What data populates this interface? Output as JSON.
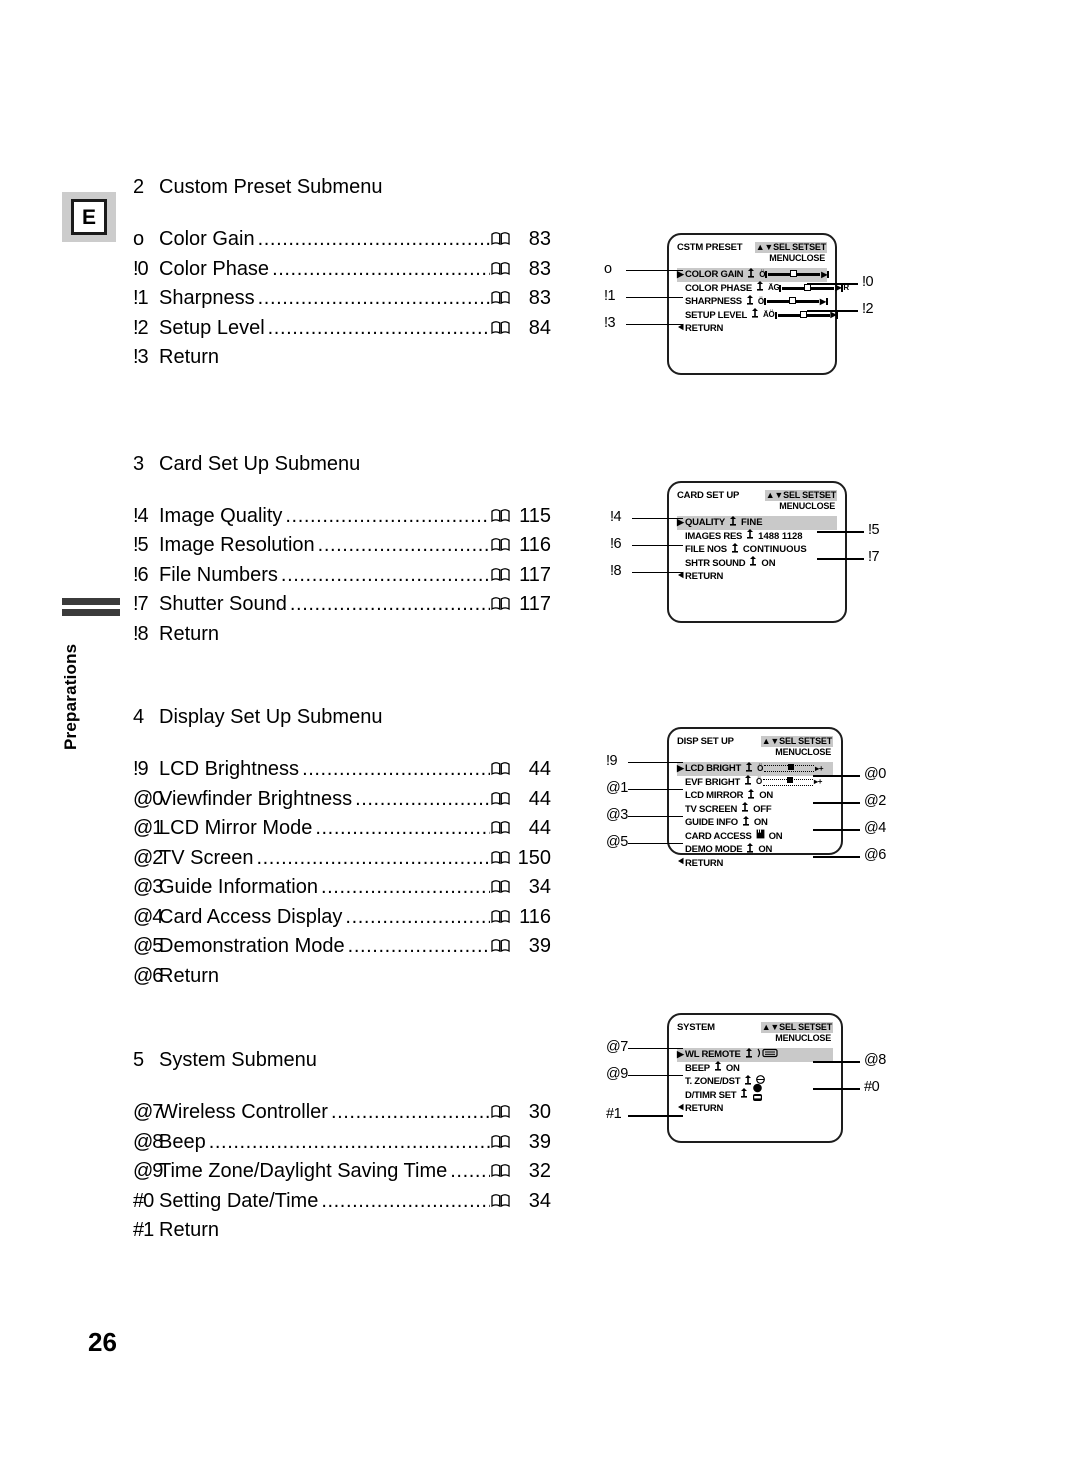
{
  "page": {
    "number": "26",
    "language_badge": "E",
    "side_tab_label": "Preparations"
  },
  "toc": {
    "groups": [
      {
        "num": "2",
        "title": "Custom Preset Submenu",
        "rows": [
          {
            "key": "o",
            "label": "Color Gain",
            "icon": "book-icon",
            "page": "83"
          },
          {
            "key": "!0",
            "label": "Color Phase",
            "icon": "book-icon",
            "page": "83"
          },
          {
            "key": "!1",
            "label": "Sharpness",
            "icon": "book-icon",
            "page": "83"
          },
          {
            "key": "!2",
            "label": "Setup Level",
            "icon": "book-icon",
            "page": "84"
          },
          {
            "key": "!3",
            "label": "Return",
            "icon": "",
            "page": ""
          }
        ]
      },
      {
        "num": "3",
        "title": "Card Set Up Submenu",
        "rows": [
          {
            "key": "!4",
            "label": "Image Quality",
            "icon": "book-icon",
            "page": "115"
          },
          {
            "key": "!5",
            "label": "Image Resolution",
            "icon": "book-icon",
            "page": "116"
          },
          {
            "key": "!6",
            "label": "File Numbers",
            "icon": "book-icon",
            "page": "117"
          },
          {
            "key": "!7",
            "label": "Shutter Sound",
            "icon": "book-icon",
            "page": "117"
          },
          {
            "key": "!8",
            "label": "Return",
            "icon": "",
            "page": ""
          }
        ]
      },
      {
        "num": "4",
        "title": "Display Set Up Submenu",
        "rows": [
          {
            "key": "!9",
            "label": "LCD Brightness",
            "icon": "book-icon",
            "page": "44"
          },
          {
            "key": "@0",
            "label": "Viewfinder Brightness",
            "icon": "book-icon",
            "page": "44"
          },
          {
            "key": "@1",
            "label": "LCD Mirror Mode",
            "icon": "book-icon",
            "page": "44"
          },
          {
            "key": "@2",
            "label": "TV Screen",
            "icon": "book-icon",
            "page": "150"
          },
          {
            "key": "@3",
            "label": "Guide Information",
            "icon": "book-icon",
            "page": "34"
          },
          {
            "key": "@4",
            "label": "Card Access Display",
            "icon": "book-icon",
            "page": "116"
          },
          {
            "key": "@5",
            "label": "Demonstration Mode",
            "icon": "book-icon",
            "page": "39"
          },
          {
            "key": "@6",
            "label": "Return",
            "icon": "",
            "page": ""
          }
        ]
      },
      {
        "num": "5",
        "title": "System Submenu",
        "rows": [
          {
            "key": "@7",
            "label": "Wireless Controller",
            "icon": "book-icon",
            "page": "30"
          },
          {
            "key": "@8",
            "label": "Beep",
            "icon": "book-icon",
            "page": "39"
          },
          {
            "key": "@9",
            "label": "Time Zone/Daylight Saving Time",
            "icon": "book-icon",
            "page": "32"
          },
          {
            "key": "#0",
            "label": "Setting Date/Time",
            "icon": "book-icon",
            "page": "34"
          },
          {
            "key": "#1",
            "label": "Return",
            "icon": "",
            "page": ""
          }
        ]
      }
    ]
  },
  "figures": {
    "hint_line1": "SEL SETSET",
    "hint_line2": "MENUCLOSE",
    "screens": [
      {
        "title": "CSTM PRESET",
        "rows": [
          {
            "name": "COLOR GAIN",
            "value": "",
            "selected": true,
            "widget": "slider-center",
            "cap_left": "Ö",
            "cap_right": ""
          },
          {
            "name": "COLOR PHASE",
            "value": "",
            "selected": false,
            "widget": "slider-center",
            "cap_left": "ÄG",
            "cap_right": "R"
          },
          {
            "name": "SHARPNESS",
            "value": "",
            "selected": false,
            "widget": "slider-center",
            "cap_left": "Ö",
            "cap_right": ""
          },
          {
            "name": "SETUP LEVEL",
            "value": "",
            "selected": false,
            "widget": "slider-center",
            "cap_left": "ÄÖ",
            "cap_right": ""
          },
          {
            "name": "RETURN",
            "value": "",
            "selected": false,
            "widget": "return",
            "cap_left": "",
            "cap_right": ""
          }
        ],
        "callouts_left": [
          {
            "label": "o",
            "row": 0
          },
          {
            "label": "!1",
            "row": 2
          },
          {
            "label": "!3",
            "row": 4
          }
        ],
        "callouts_right": [
          {
            "label": "!0",
            "row": 1
          },
          {
            "label": "!2",
            "row": 3
          }
        ]
      },
      {
        "title": "CARD SET UP",
        "rows": [
          {
            "name": "QUALITY",
            "value": "FINE",
            "selected": true,
            "widget": "text"
          },
          {
            "name": "IMAGES RES",
            "value": "1488  1128",
            "selected": false,
            "widget": "text"
          },
          {
            "name": "FILE NOS",
            "value": "CONTINUOUS",
            "selected": false,
            "widget": "text"
          },
          {
            "name": "SHTR SOUND",
            "value": "ON",
            "selected": false,
            "widget": "text"
          },
          {
            "name": "RETURN",
            "value": "",
            "selected": false,
            "widget": "return"
          }
        ],
        "callouts_left": [
          {
            "label": "!4",
            "row": 0
          },
          {
            "label": "!6",
            "row": 2
          },
          {
            "label": "!8",
            "row": 4
          }
        ],
        "callouts_right": [
          {
            "label": "!5",
            "row": 1
          },
          {
            "label": "!7",
            "row": 3
          }
        ]
      },
      {
        "title": "DISP SET UP",
        "rows": [
          {
            "name": "LCD BRIGHT",
            "value": "",
            "selected": true,
            "widget": "slider-dotted"
          },
          {
            "name": "EVF BRIGHT",
            "value": "",
            "selected": false,
            "widget": "slider-dotted"
          },
          {
            "name": "LCD MIRROR",
            "value": "ON",
            "selected": false,
            "widget": "text"
          },
          {
            "name": "TV SCREEN",
            "value": "OFF",
            "selected": false,
            "widget": "text"
          },
          {
            "name": "GUIDE INFO",
            "value": "ON",
            "selected": false,
            "widget": "text"
          },
          {
            "name": "CARD ACCESS",
            "value": "ON",
            "selected": false,
            "widget": "text"
          },
          {
            "name": "DEMO MODE",
            "value": "ON",
            "selected": false,
            "widget": "text"
          },
          {
            "name": "RETURN",
            "value": "",
            "selected": false,
            "widget": "return"
          }
        ],
        "callouts_left": [
          {
            "label": "!9",
            "row": 0
          },
          {
            "label": "@1",
            "row": 2
          },
          {
            "label": "@3",
            "row": 4
          },
          {
            "label": "@5",
            "row": 6
          }
        ],
        "callouts_right": [
          {
            "label": "@0",
            "row": 1
          },
          {
            "label": "@2",
            "row": 3
          },
          {
            "label": "@4",
            "row": 5
          },
          {
            "label": "@6",
            "row": 7
          }
        ]
      },
      {
        "title": "SYSTEM",
        "rows": [
          {
            "name": "WL REMOTE",
            "value": "",
            "selected": true,
            "widget": "remote"
          },
          {
            "name": "BEEP",
            "value": "ON",
            "selected": false,
            "widget": "text"
          },
          {
            "name": "T. ZONE/DST",
            "value": "",
            "selected": false,
            "widget": "zone"
          },
          {
            "name": "D/TIMR SET",
            "value": "",
            "selected": false,
            "widget": "clock"
          },
          {
            "name": "RETURN",
            "value": "",
            "selected": false,
            "widget": "return"
          }
        ],
        "callouts_left": [
          {
            "label": "@7",
            "row": 0
          },
          {
            "label": "@9",
            "row": 2
          },
          {
            "label": "#1",
            "row": 5
          }
        ],
        "callouts_right": [
          {
            "label": "@8",
            "row": 1
          },
          {
            "label": "#0",
            "row": 3
          }
        ]
      }
    ]
  },
  "colors": {
    "highlight": "#c9c9c9",
    "badge_bg": "#cccccc",
    "ink": "#000000",
    "tab_bar": "#3b3b3b"
  }
}
